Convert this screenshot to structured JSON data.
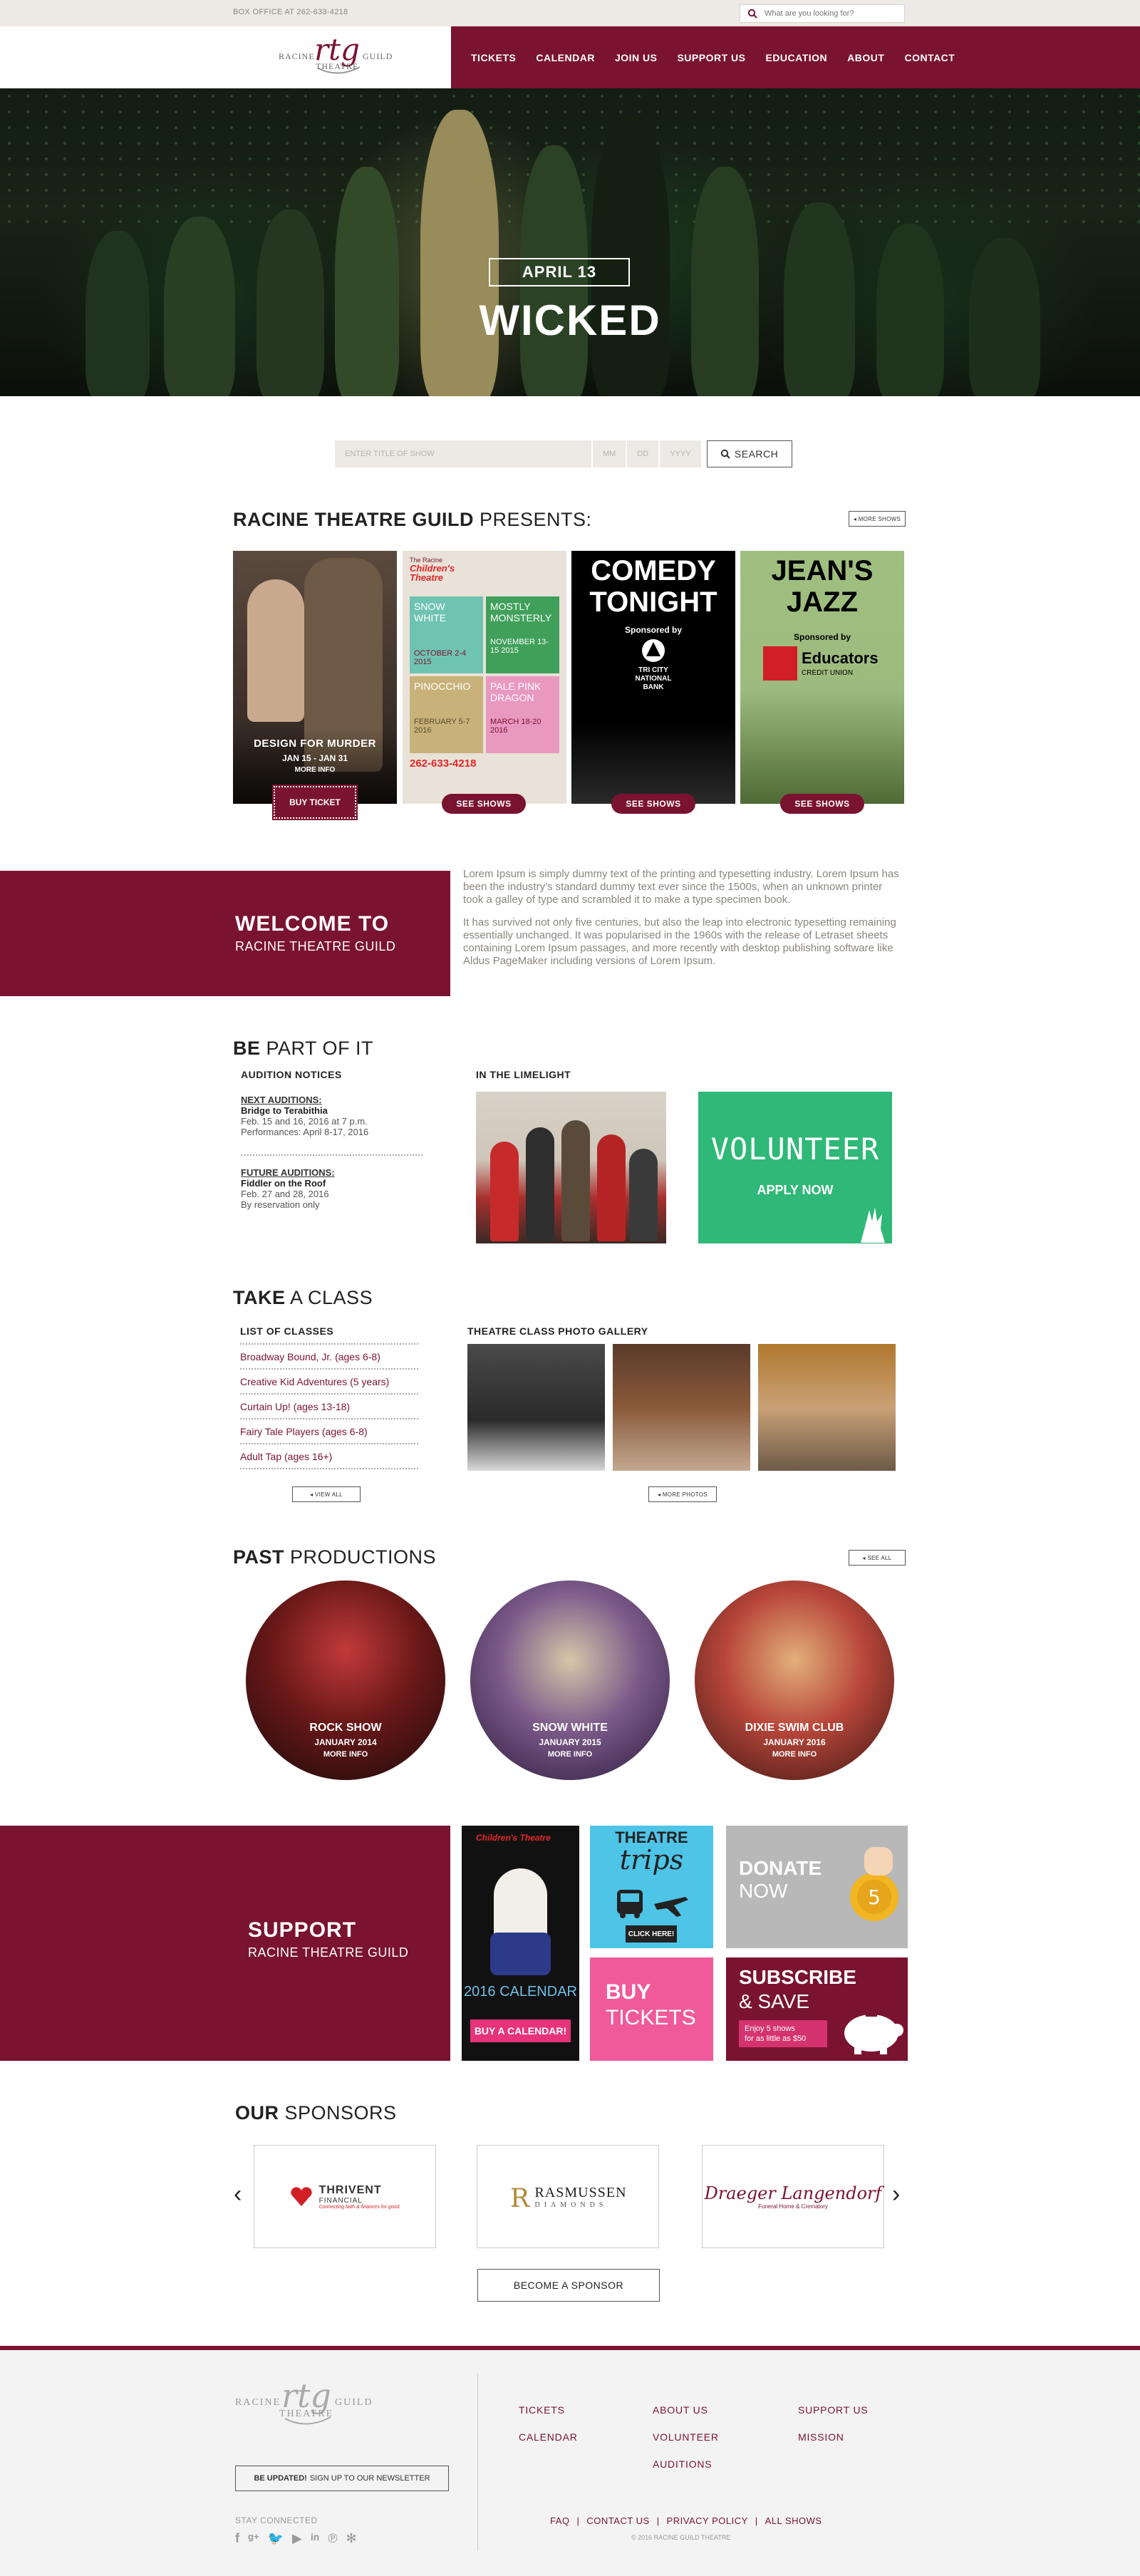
{
  "topbar": {
    "box_office": "BOX OFFICE AT 262-633-4218",
    "search_placeholder": "What are you looking for?"
  },
  "logo": {
    "left": "RACINE",
    "right": "GUILD",
    "bottom": "THEATRE",
    "mark": "rtg"
  },
  "nav": [
    "TICKETS",
    "CALENDAR",
    "JOIN US",
    "SUPPORT US",
    "EDUCATION",
    "ABOUT",
    "CONTACT"
  ],
  "hero": {
    "date": "APRIL 13",
    "title": "WICKED"
  },
  "show_search": {
    "title_placeholder": "ENTER TITLE OF SHOW",
    "mm": "MM",
    "dd": "DD",
    "yyyy": "YYYY",
    "button": "SEARCH"
  },
  "presents": {
    "heading_bold": "RACINE THEATRE GUILD",
    "heading_light": "PRESENTS:",
    "more_button": "MORE SHOWS",
    "cards": [
      {
        "title": "DESIGN FOR MURDER",
        "dates": "JAN 15 - JAN 31",
        "more": "MORE INFO",
        "button": "BUY TICKET"
      },
      {
        "poster_title1": "The Racine",
        "poster_title2": "Children's Theatre",
        "shows": [
          "SNOW WHITE",
          "MOSTLY MONSTERLY",
          "PINOCCHIO",
          "PALE PINK DRAGON"
        ],
        "dates": [
          "OCTOBER 2-4 2015",
          "NOVEMBER 13-15 2015",
          "FEBRUARY 5-7 2016",
          "MARCH 18-20 2016"
        ],
        "phone": "262-633-4218",
        "button": "SEE SHOWS"
      },
      {
        "line1": "COMEDY",
        "line2": "TONIGHT",
        "sponsored": "Sponsored by",
        "sponsor1": "TRI CITY",
        "sponsor2": "NATIONAL",
        "sponsor3": "BANK",
        "button": "SEE SHOWS"
      },
      {
        "line1": "JEAN'S",
        "line2": "JAZZ",
        "sponsored": "Sponsored by",
        "sponsor1": "Educators",
        "sponsor2": "CREDIT UNION",
        "button": "SEE SHOWS"
      }
    ]
  },
  "welcome": {
    "line1": "WELCOME TO",
    "line2": "RACINE THEATRE GUILD",
    "p1": "Lorem Ipsum is simply dummy text of the printing and typesetting industry. Lorem Ipsum has been the industry's standard dummy text ever since the 1500s, when an unknown printer took a galley of type and scrambled it to make a type specimen book.",
    "p2": "It has survived not only five centuries, but also the leap into electronic typesetting remaining essentially unchanged. It was popularised in the 1960s with the release of Letraset sheets containing Lorem Ipsum passages, and more recently with desktop publishing software like Aldus PageMaker including versions of Lorem Ipsum."
  },
  "be_part": {
    "heading_bold": "BE",
    "heading_light": "PART OF IT",
    "audition_heading": "AUDITION NOTICES",
    "next_label": "NEXT AUDITIONS:",
    "next_show": "Bridge to Terabithia",
    "next_line1": "Feb. 15 and 16, 2016 at 7 p.m.",
    "next_line2": "Performances: April 8-17, 2016",
    "future_label": "FUTURE AUDITIONS:",
    "future_show": "Fiddler on the Roof",
    "future_line1": "Feb. 27 and 28, 2016",
    "future_line2": "By reservation only",
    "limelight_heading": "IN THE LIMELIGHT",
    "volunteer_title": "VOLUNTEER",
    "volunteer_sub": "APPLY NOW"
  },
  "take_class": {
    "heading_bold": "TAKE",
    "heading_light": "A CLASS",
    "list_heading": "LIST OF CLASSES",
    "classes": [
      "Broadway Bound, Jr. (ages 6-8)",
      "Creative Kid Adventures (5 years)",
      "Curtain Up! (ages 13-18)",
      "Fairy Tale Players (ages 6-8)",
      "Adult Tap (ages 16+)"
    ],
    "view_all": "VIEW ALL",
    "gallery_heading": "THEATRE CLASS PHOTO GALLERY",
    "more_photos": "MORE PHOTOS"
  },
  "past": {
    "heading_bold": "PAST",
    "heading_light": "PRODUCTIONS",
    "see_all": "SEE ALL",
    "items": [
      {
        "title": "ROCK SHOW",
        "date": "JANUARY 2014",
        "more": "MORE INFO"
      },
      {
        "title": "SNOW WHITE",
        "date": "JANUARY 2015",
        "more": "MORE INFO"
      },
      {
        "title": "DIXIE SWIM CLUB",
        "date": "JANUARY 2016",
        "more": "MORE INFO"
      }
    ]
  },
  "support": {
    "line1": "SUPPORT",
    "line2": "RACINE THEATRE GUILD",
    "calendar_top": "Children's Theatre",
    "calendar_title": "2016 CALENDAR",
    "calendar_btn": "BUY A CALENDAR!",
    "trips_line1": "THEATRE",
    "trips_line2": "trips",
    "trips_btn": "CLICK HERE!",
    "donate_line1": "DONATE",
    "donate_line2": "NOW",
    "buy_line1": "BUY",
    "buy_line2": "TICKETS",
    "subscribe_line1": "SUBSCRIBE",
    "subscribe_line2": "& SAVE",
    "subscribe_note1": "Enjoy 5 shows",
    "subscribe_note2": "for as little as $50"
  },
  "sponsors": {
    "heading_bold": "OUR",
    "heading_light": "SPONSORS",
    "items": [
      {
        "name": "THRIVENT",
        "sub": "FINANCIAL",
        "tag": "Connecting faith & finances for good."
      },
      {
        "name": "RASMUSSEN",
        "sub": "DIAMONDS"
      },
      {
        "name": "Draeger Langendorf",
        "sub": "Funeral Home & Crematory"
      }
    ],
    "become": "BECOME A SPONSOR"
  },
  "footer": {
    "newsletter_bold": "BE UPDATED!",
    "newsletter_rest": "SIGN UP TO OUR NEWSLETTER",
    "stay_connected": "STAY CONNECTED",
    "col1": [
      "TICKETS",
      "CALENDAR"
    ],
    "col2": [
      "ABOUT US",
      "VOLUNTEER",
      "AUDITIONS"
    ],
    "col3": [
      "SUPPORT US",
      "MISSION"
    ],
    "bottom_links": [
      "FAQ",
      "CONTACT US",
      "PRIVACY POLICY",
      "ALL SHOWS"
    ],
    "copyright": "© 2016 RACINE GUILD THEATRE"
  },
  "colors": {
    "brand": "#7a1330",
    "volunteer": "#2fb877",
    "trips": "#4ec4e6",
    "buy": "#f05a9a"
  }
}
